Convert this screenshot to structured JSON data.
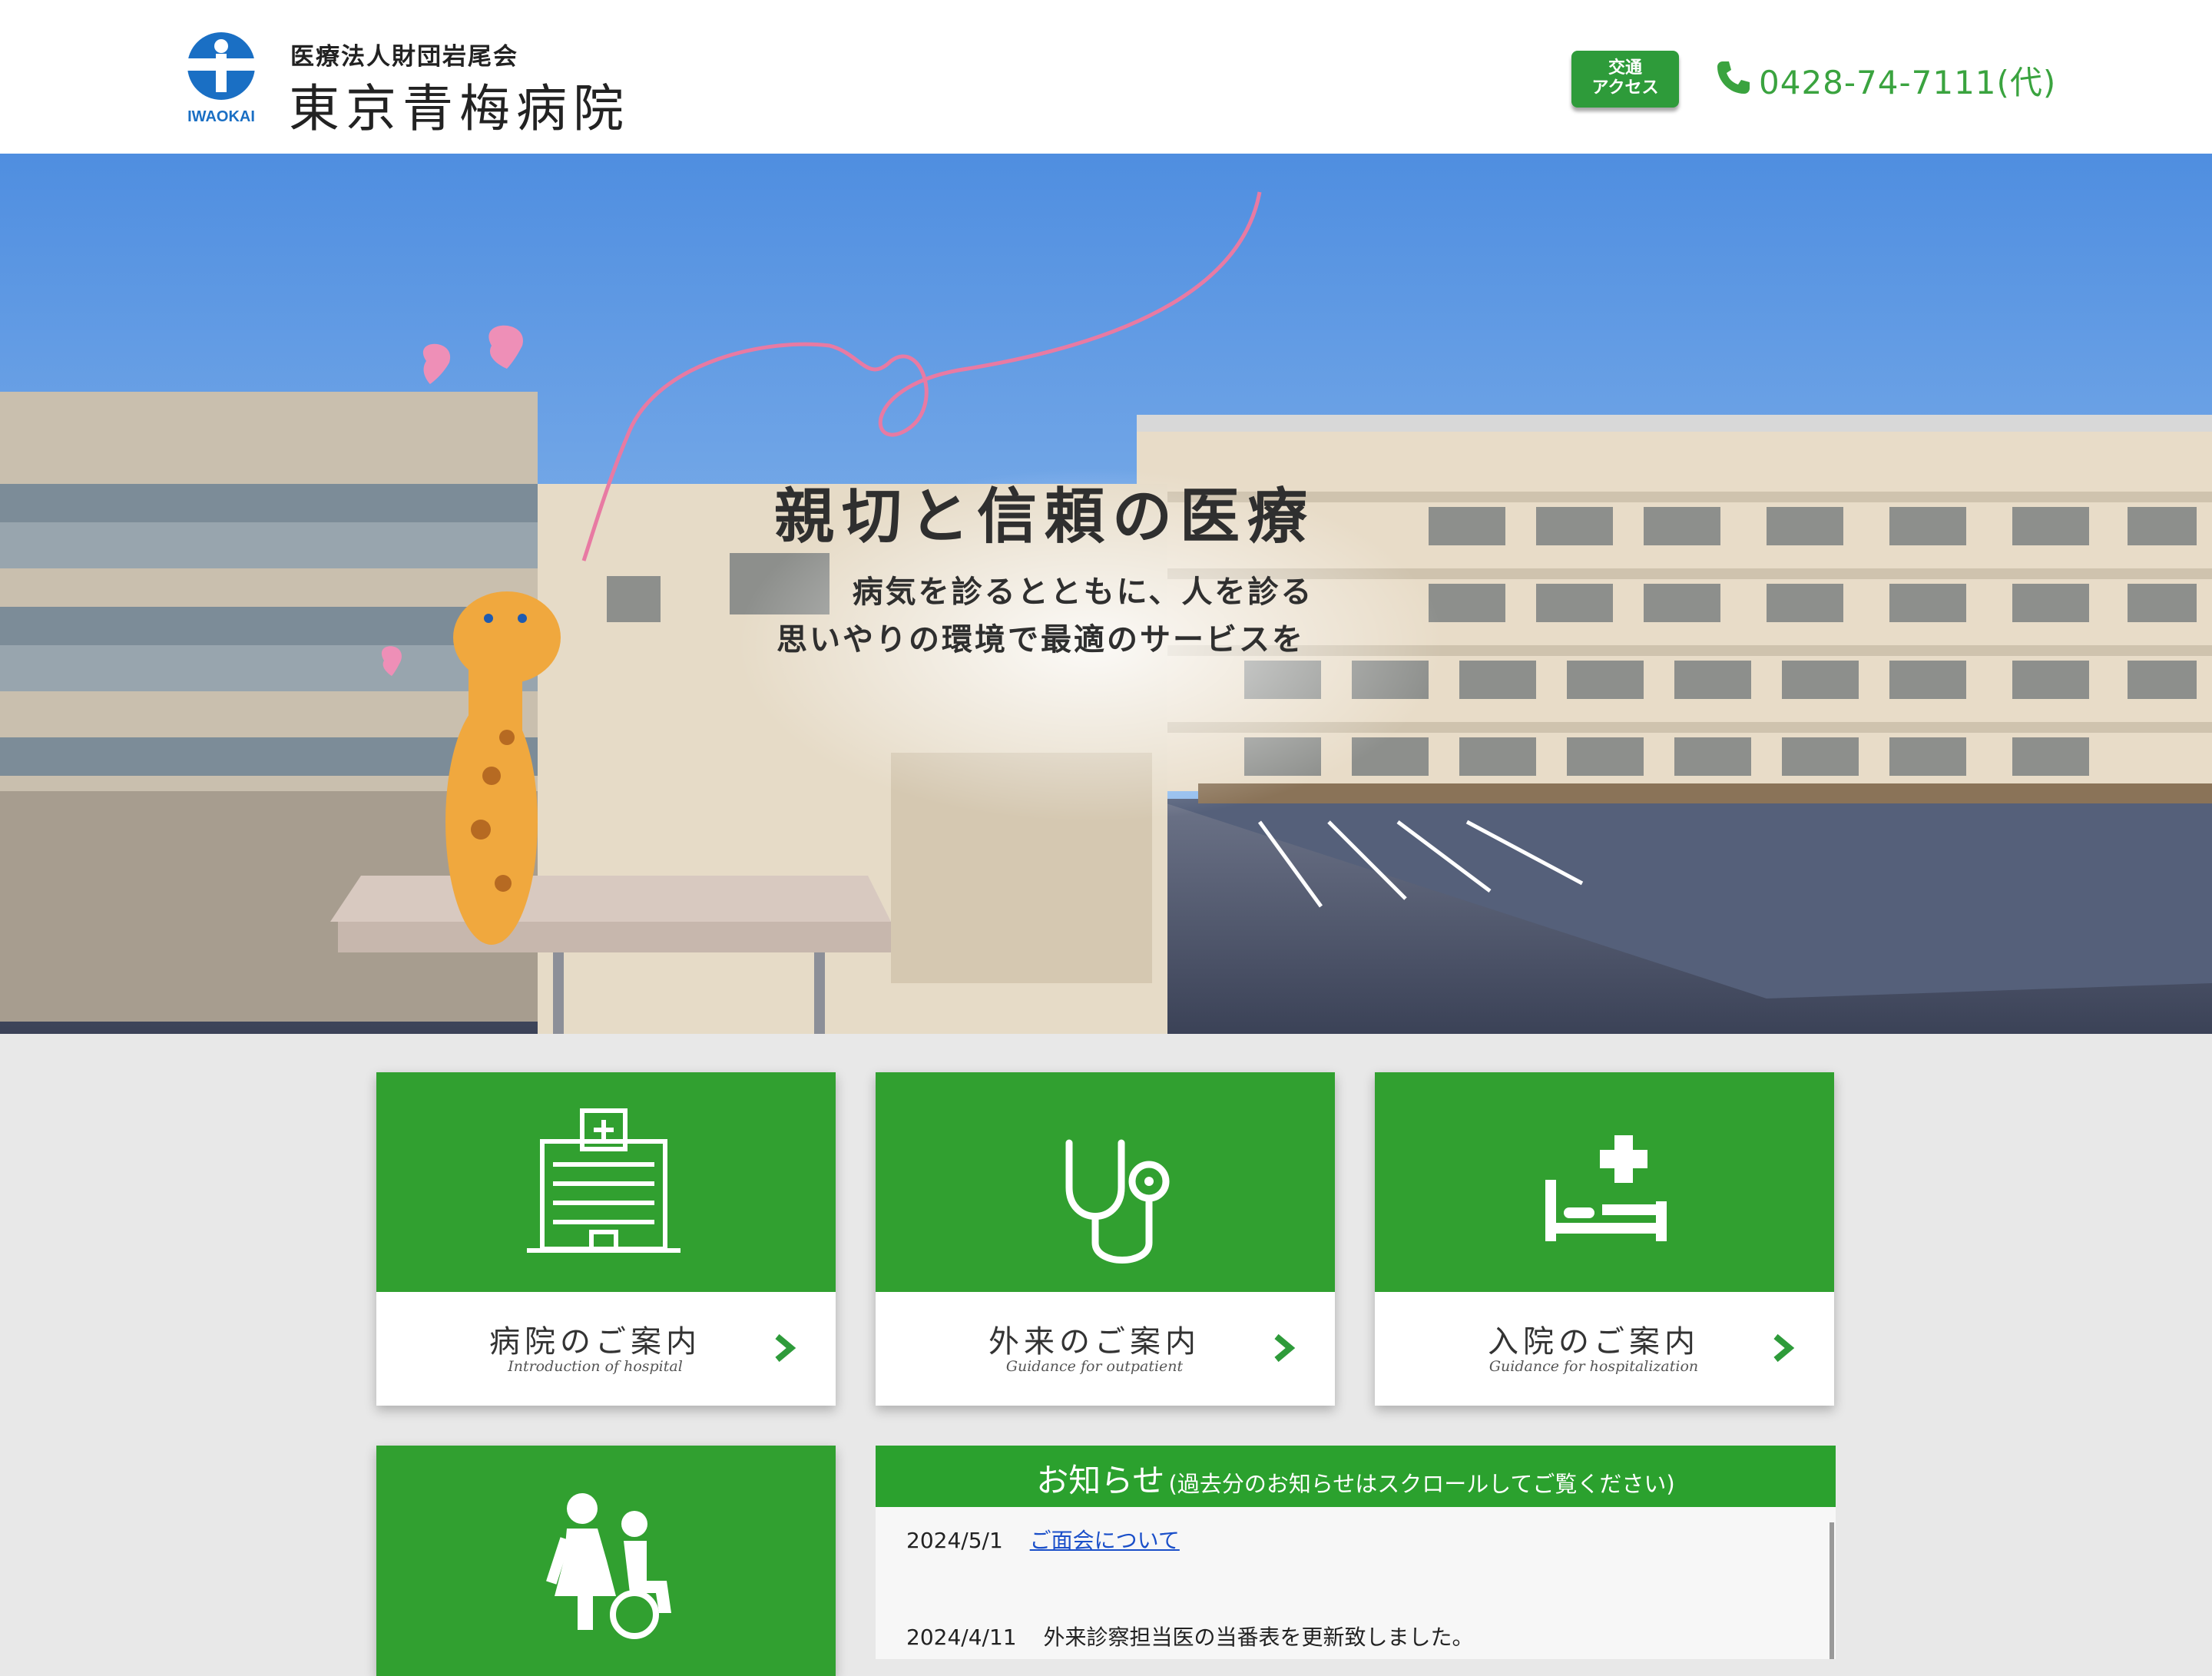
{
  "header": {
    "org_name": "医療法人財団岩尾会",
    "hospital_name": "東京青梅病院",
    "logo_text": "IWAOKAI",
    "access_line1": "交通",
    "access_line2": "アクセス",
    "phone": "0428-74-7111(代)",
    "brand_color": "#2e9b3a"
  },
  "hero": {
    "title": "親切と信頼の医療",
    "line1": "病気を診るとともに、人を診る",
    "line2": "思いやりの環境で最適のサービスを"
  },
  "cards": [
    {
      "title": "病院のご案内",
      "subtitle": "Introduction of hospital",
      "icon": "hospital-building-icon"
    },
    {
      "title": "外来のご案内",
      "subtitle": "Guidance for outpatient",
      "icon": "stethoscope-icon"
    },
    {
      "title": "入院のご案内",
      "subtitle": "Guidance for hospitalization",
      "icon": "hospital-bed-icon"
    },
    {
      "title": "",
      "subtitle": "",
      "icon": "nursing-care-icon"
    }
  ],
  "news": {
    "heading": "お知らせ",
    "note": "(過去分のお知らせはスクロールしてご覧ください)",
    "items": [
      {
        "date": "2024/5/1",
        "text": "ご面会について",
        "link": true
      },
      {
        "date": "2024/4/11",
        "text": "外来診察担当医の当番表を更新致しました。",
        "link": false
      }
    ]
  }
}
